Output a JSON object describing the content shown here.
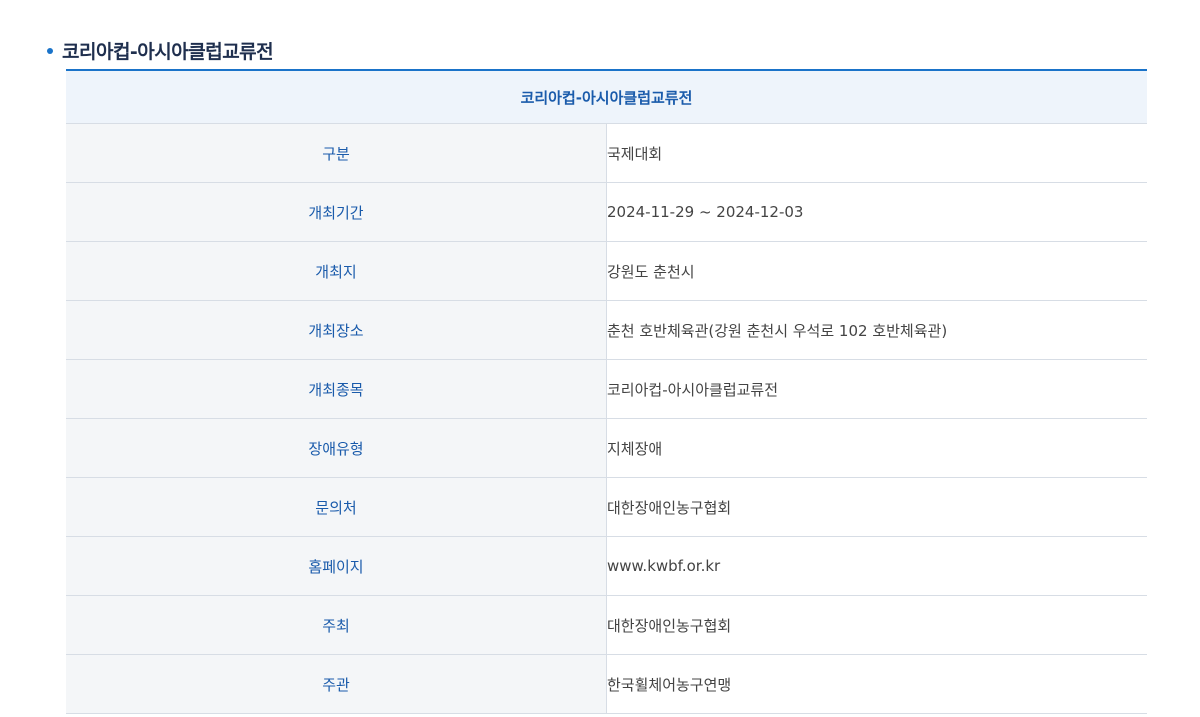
{
  "section": {
    "title": "코리아컵-아시아클럽교류전"
  },
  "table": {
    "header": "코리아컵-아시아클럽교류전",
    "rows": [
      {
        "label": "구분",
        "value": "국제대회"
      },
      {
        "label": "개최기간",
        "value": "2024-11-29 ~ 2024-12-03"
      },
      {
        "label": "개최지",
        "value": "강원도 춘천시"
      },
      {
        "label": "개최장소",
        "value": "춘천 호반체육관(강원 춘천시 우석로 102 호반체육관)"
      },
      {
        "label": "개최종목",
        "value": "코리아컵-아시아클럽교류전"
      },
      {
        "label": "장애유형",
        "value": "지체장애"
      },
      {
        "label": "문의처",
        "value": "대한장애인농구협회"
      },
      {
        "label": "홈페이지",
        "value": "www.kwbf.or.kr"
      },
      {
        "label": "주최",
        "value": "대한장애인농구협회"
      },
      {
        "label": "주관",
        "value": "한국휠체어농구연맹"
      }
    ]
  },
  "colors": {
    "accent": "#1a73c9",
    "label_text": "#1a5bab",
    "header_bg": "#eef4fb",
    "label_bg": "#f4f6f8"
  }
}
